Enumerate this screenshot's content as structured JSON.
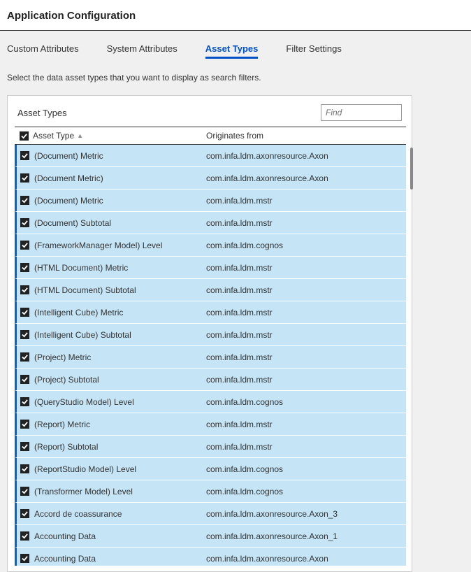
{
  "page": {
    "title": "Application Configuration"
  },
  "tabs": [
    {
      "id": "custom-attributes",
      "label": "Custom Attributes",
      "active": false
    },
    {
      "id": "system-attributes",
      "label": "System Attributes",
      "active": false
    },
    {
      "id": "asset-types",
      "label": "Asset Types",
      "active": true
    },
    {
      "id": "filter-settings",
      "label": "Filter Settings",
      "active": false
    }
  ],
  "description": "Select the data asset types that you want to display as search filters.",
  "panel": {
    "title": "Asset Types",
    "find_placeholder": "Find"
  },
  "table": {
    "header_checked": true,
    "col_asset_type": "Asset Type",
    "col_originates_from": "Originates from",
    "sort_asc": true
  },
  "rows": [
    {
      "checked": true,
      "asset_type": "(Document) Metric",
      "originates_from": "com.infa.ldm.axonresource.Axon"
    },
    {
      "checked": true,
      "asset_type": "(Document Metric)",
      "originates_from": "com.infa.ldm.axonresource.Axon"
    },
    {
      "checked": true,
      "asset_type": "(Document) Metric",
      "originates_from": "com.infa.ldm.mstr"
    },
    {
      "checked": true,
      "asset_type": "(Document) Subtotal",
      "originates_from": "com.infa.ldm.mstr"
    },
    {
      "checked": true,
      "asset_type": "(FrameworkManager Model) Level",
      "originates_from": "com.infa.ldm.cognos"
    },
    {
      "checked": true,
      "asset_type": "(HTML Document) Metric",
      "originates_from": "com.infa.ldm.mstr"
    },
    {
      "checked": true,
      "asset_type": "(HTML Document) Subtotal",
      "originates_from": "com.infa.ldm.mstr"
    },
    {
      "checked": true,
      "asset_type": "(Intelligent Cube) Metric",
      "originates_from": "com.infa.ldm.mstr"
    },
    {
      "checked": true,
      "asset_type": "(Intelligent Cube) Subtotal",
      "originates_from": "com.infa.ldm.mstr"
    },
    {
      "checked": true,
      "asset_type": "(Project) Metric",
      "originates_from": "com.infa.ldm.mstr"
    },
    {
      "checked": true,
      "asset_type": "(Project) Subtotal",
      "originates_from": "com.infa.ldm.mstr"
    },
    {
      "checked": true,
      "asset_type": "(QueryStudio Model) Level",
      "originates_from": "com.infa.ldm.cognos"
    },
    {
      "checked": true,
      "asset_type": "(Report) Metric",
      "originates_from": "com.infa.ldm.mstr"
    },
    {
      "checked": true,
      "asset_type": "(Report) Subtotal",
      "originates_from": "com.infa.ldm.mstr"
    },
    {
      "checked": true,
      "asset_type": "(ReportStudio Model) Level",
      "originates_from": "com.infa.ldm.cognos"
    },
    {
      "checked": true,
      "asset_type": "(Transformer Model) Level",
      "originates_from": "com.infa.ldm.cognos"
    },
    {
      "checked": true,
      "asset_type": "Accord de coassurance",
      "originates_from": "com.infa.ldm.axonresource.Axon_3"
    },
    {
      "checked": true,
      "asset_type": "Accounting Data",
      "originates_from": "com.infa.ldm.axonresource.Axon_1"
    },
    {
      "checked": true,
      "asset_type": "Accounting Data",
      "originates_from": "com.infa.ldm.axonresource.Axon"
    }
  ]
}
